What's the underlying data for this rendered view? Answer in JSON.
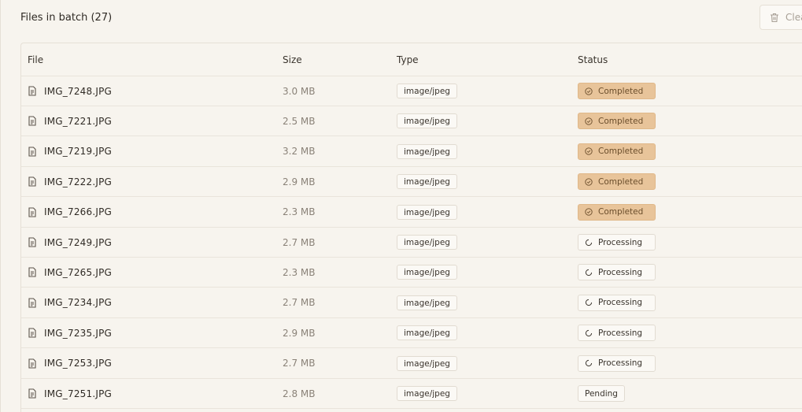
{
  "header": {
    "title": "Files in batch (27)",
    "clear_label": "Clear"
  },
  "table": {
    "columns": [
      "File",
      "Size",
      "Type",
      "Status"
    ],
    "rows": [
      {
        "file": "IMG_7248.JPG",
        "size": "3.0 MB",
        "type": "image/jpeg",
        "status": "Completed"
      },
      {
        "file": "IMG_7221.JPG",
        "size": "2.5 MB",
        "type": "image/jpeg",
        "status": "Completed"
      },
      {
        "file": "IMG_7219.JPG",
        "size": "3.2 MB",
        "type": "image/jpeg",
        "status": "Completed"
      },
      {
        "file": "IMG_7222.JPG",
        "size": "2.9 MB",
        "type": "image/jpeg",
        "status": "Completed"
      },
      {
        "file": "IMG_7266.JPG",
        "size": "2.3 MB",
        "type": "image/jpeg",
        "status": "Completed"
      },
      {
        "file": "IMG_7249.JPG",
        "size": "2.7 MB",
        "type": "image/jpeg",
        "status": "Processing"
      },
      {
        "file": "IMG_7265.JPG",
        "size": "2.3 MB",
        "type": "image/jpeg",
        "status": "Processing"
      },
      {
        "file": "IMG_7234.JPG",
        "size": "2.7 MB",
        "type": "image/jpeg",
        "status": "Processing"
      },
      {
        "file": "IMG_7235.JPG",
        "size": "2.9 MB",
        "type": "image/jpeg",
        "status": "Processing"
      },
      {
        "file": "IMG_7253.JPG",
        "size": "2.7 MB",
        "type": "image/jpeg",
        "status": "Processing"
      },
      {
        "file": "IMG_7251.JPG",
        "size": "2.8 MB",
        "type": "image/jpeg",
        "status": "Pending"
      }
    ]
  },
  "icons": {
    "file": "file-text-icon",
    "completed": "check-circle-icon",
    "processing": "spinner-icon",
    "clear": "trash-icon"
  },
  "colors": {
    "background": "#f7f4ee",
    "completed_badge": "#e8c49a",
    "completed_text": "#6b4e2c",
    "border": "#e6e0d6"
  }
}
